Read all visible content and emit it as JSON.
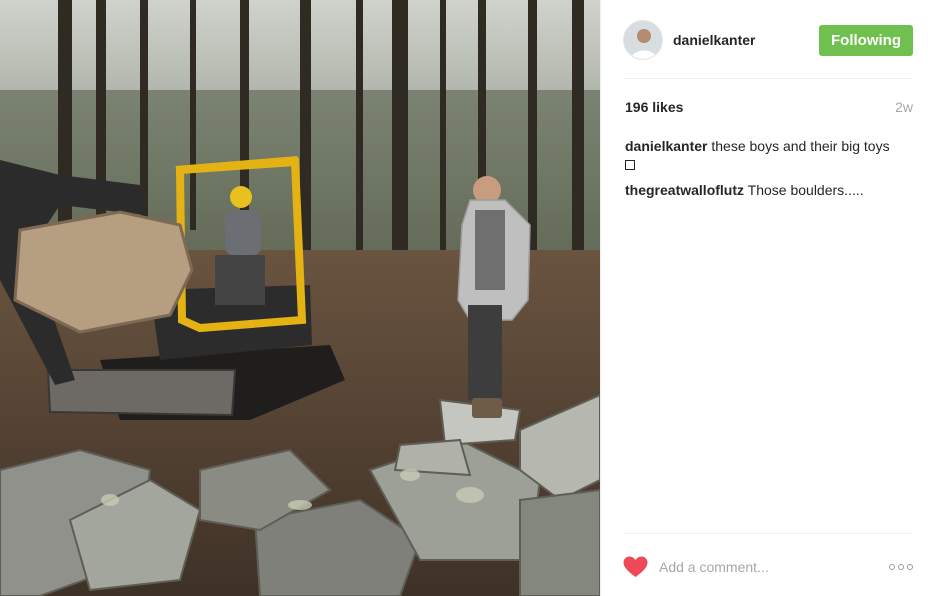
{
  "post": {
    "photo_alt": "Two men outdoors in a forest with a yellow mini excavator lifting a large boulder near a pile of stones"
  },
  "header": {
    "username": "danielkanter",
    "follow_label": "Following"
  },
  "stats": {
    "likes": "196 likes",
    "age": "2w"
  },
  "comments": [
    {
      "user": "danielkanter",
      "text": "these boys and their big toys"
    },
    {
      "user": "thegreatwalloflutz",
      "text": "Those boulders....."
    }
  ],
  "footer": {
    "comment_placeholder": "Add a comment..."
  },
  "colors": {
    "follow_green": "#70c050",
    "heart_red": "#ed4956",
    "muted_gray": "#a5a7aa"
  },
  "icons": {
    "like": "heart-icon",
    "more": "more-options-icon"
  }
}
